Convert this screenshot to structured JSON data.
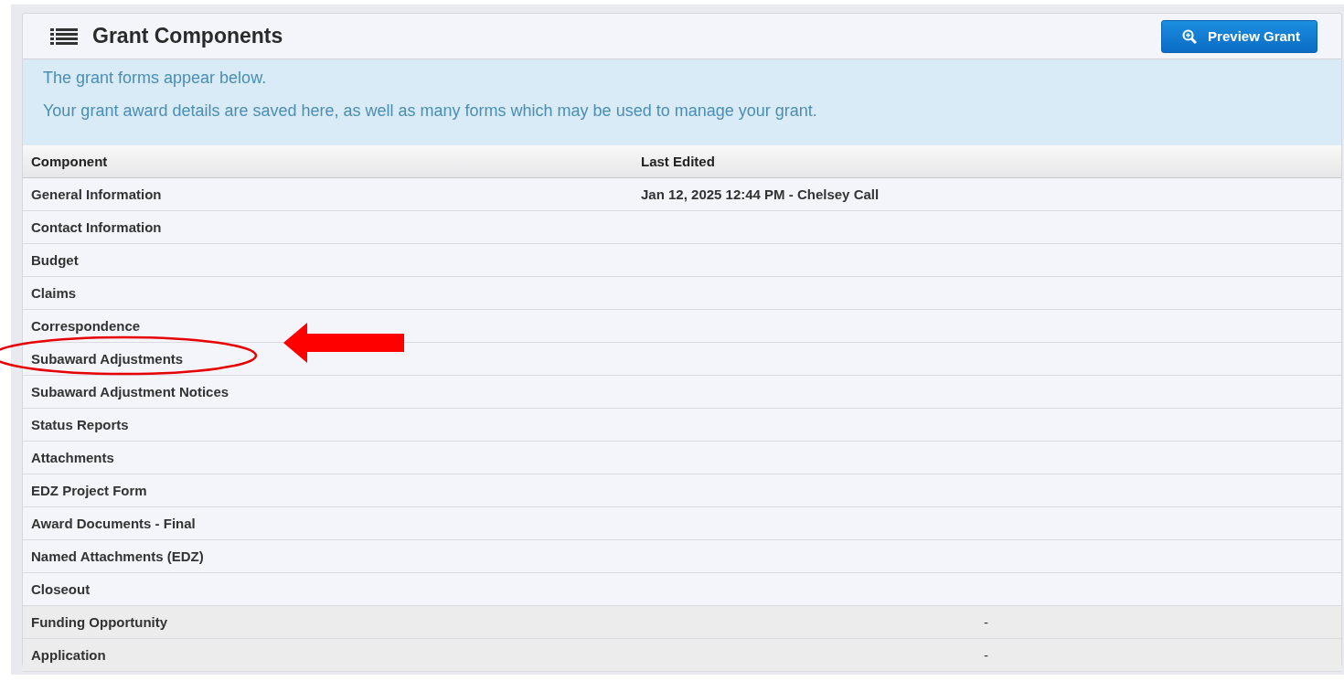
{
  "panel": {
    "title": "Grant Components",
    "preview_button": "Preview Grant"
  },
  "info": [
    "The grant forms appear below.",
    "Your grant award details are saved here, as well as many forms which may be used to manage your grant."
  ],
  "table": {
    "columns": [
      "Component",
      "Last Edited"
    ],
    "rows": [
      {
        "kind": "component",
        "component": "General Information",
        "last_edited": "Jan 12, 2025 12:44 PM - Chelsey Call",
        "circled": false
      },
      {
        "kind": "component",
        "component": "Contact Information",
        "circled": false
      },
      {
        "kind": "component",
        "component": "Budget",
        "circled": false
      },
      {
        "kind": "component",
        "component": "Claims",
        "circled": false
      },
      {
        "kind": "component",
        "component": "Correspondence",
        "circled": false
      },
      {
        "kind": "component",
        "component": "Subaward Adjustments",
        "circled": true
      },
      {
        "kind": "component",
        "component": "Subaward Adjustment Notices",
        "circled": false
      },
      {
        "kind": "component",
        "component": "Status Reports",
        "circled": false
      },
      {
        "kind": "component",
        "component": "Attachments",
        "circled": false
      },
      {
        "kind": "component",
        "component": "EDZ Project Form",
        "circled": false
      },
      {
        "kind": "component",
        "component": "Award Documents - Final",
        "circled": false
      },
      {
        "kind": "component",
        "component": "Named Attachments (EDZ)",
        "circled": false
      },
      {
        "kind": "component",
        "component": "Closeout",
        "circled": false
      },
      {
        "kind": "reference",
        "component": "Funding Opportunity",
        "column_3": "-",
        "circled": false
      },
      {
        "kind": "reference",
        "component": "Application",
        "column_3": "-",
        "circled": false
      }
    ]
  }
}
